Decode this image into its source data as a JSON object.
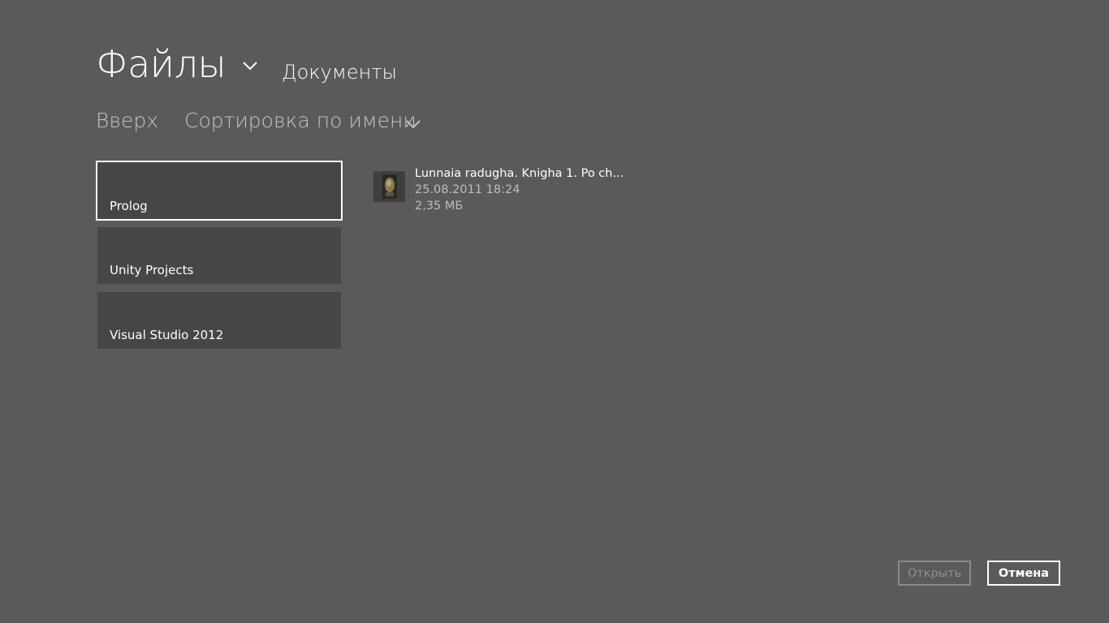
{
  "header": {
    "title": "Файлы",
    "title_chevron_icon": "chevron-down-icon",
    "location": "Документы"
  },
  "toolbar": {
    "up_label": "Вверх",
    "sort_label": "Сортировка по имени",
    "sort_chevron_icon": "chevron-down-icon"
  },
  "folders": [
    {
      "label": "Prolog",
      "selected": true
    },
    {
      "label": "Unity Projects",
      "selected": false
    },
    {
      "label": "Visual Studio 2012",
      "selected": false
    }
  ],
  "files": [
    {
      "name": "Lunnaia radugha. Knigha 1. Po ch...",
      "date": "25.08.2011 18:24",
      "size": "2,35 МБ",
      "thumbnail_icon": "book-cover-thumbnail"
    }
  ],
  "buttons": {
    "open_label": "Открыть",
    "open_enabled": false,
    "cancel_label": "Отмена"
  },
  "colors": {
    "background": "#5a5a5a",
    "tile": "#464646",
    "accent": "#ffffff",
    "muted_text": "#bdbdbd"
  }
}
